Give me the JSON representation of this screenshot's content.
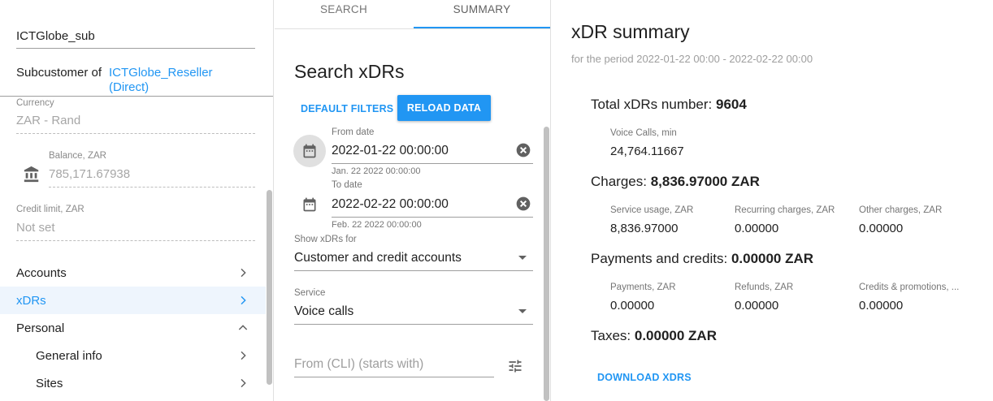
{
  "colors": {
    "accent": "#2196f3",
    "active_bg": "#eef5fd"
  },
  "sidebar": {
    "customer_name": "ICTGlobe_sub",
    "subcustomer_label": "Subcustomer of",
    "subcustomer_link": "ICTGlobe_Reseller (Direct)",
    "currency_label": "Currency",
    "currency_value": "ZAR - Rand",
    "balance_label": "Balance, ZAR",
    "balance_value": "785,171.67938",
    "balance_icon": "bank-icon",
    "credit_label": "Credit limit, ZAR",
    "credit_value": "Not set",
    "nav": [
      {
        "label": "Accounts",
        "icon": "chevron-right-icon"
      },
      {
        "label": "xDRs",
        "icon": "chevron-right-icon",
        "active": true
      },
      {
        "label": "Personal",
        "icon": "chevron-up-icon"
      },
      {
        "label": "General info",
        "icon": "chevron-right-icon"
      },
      {
        "label": "Sites",
        "icon": "chevron-right-icon"
      }
    ]
  },
  "middle": {
    "tabs": [
      {
        "label": "SEARCH"
      },
      {
        "label": "SUMMARY",
        "active": true
      }
    ],
    "title": "Search xDRs",
    "default_filters": "DEFAULT FILTERS",
    "reload_data": "RELOAD DATA",
    "from_date": {
      "label": "From date",
      "value": "2022-01-22 00:00:00",
      "hint": "Jan. 22 2022 00:00:00"
    },
    "to_date": {
      "label": "To date",
      "value": "2022-02-22 00:00:00",
      "hint": "Feb. 22 2022 00:00:00"
    },
    "show_for": {
      "label": "Show xDRs for",
      "value": "Customer and credit accounts"
    },
    "service": {
      "label": "Service",
      "value": "Voice calls"
    },
    "cli_placeholder": "From (CLI) (starts with)"
  },
  "summary": {
    "title": "xDR summary",
    "period": "for the period 2022-01-22 00:00 - 2022-02-22 00:00",
    "total_label": "Total xDRs number:",
    "total_value": "9604",
    "voice_label": "Voice Calls, min",
    "voice_value": "24,764.11667",
    "charges_label": "Charges:",
    "charges_value": "8,836.97000 ZAR",
    "service_usage_label": "Service usage, ZAR",
    "service_usage_value": "8,836.97000",
    "recurring_label": "Recurring charges, ZAR",
    "recurring_value": "0.00000",
    "other_label": "Other charges, ZAR",
    "other_value": "0.00000",
    "payments_credits_label": "Payments and credits:",
    "payments_credits_value": "0.00000 ZAR",
    "payments_label": "Payments, ZAR",
    "payments_value": "0.00000",
    "refunds_label": "Refunds, ZAR",
    "refunds_value": "0.00000",
    "credits_promo_label": "Credits & promotions, ...",
    "credits_promo_value": "0.00000",
    "taxes_label": "Taxes:",
    "taxes_value": "0.00000 ZAR",
    "download": "DOWNLOAD XDRS"
  }
}
